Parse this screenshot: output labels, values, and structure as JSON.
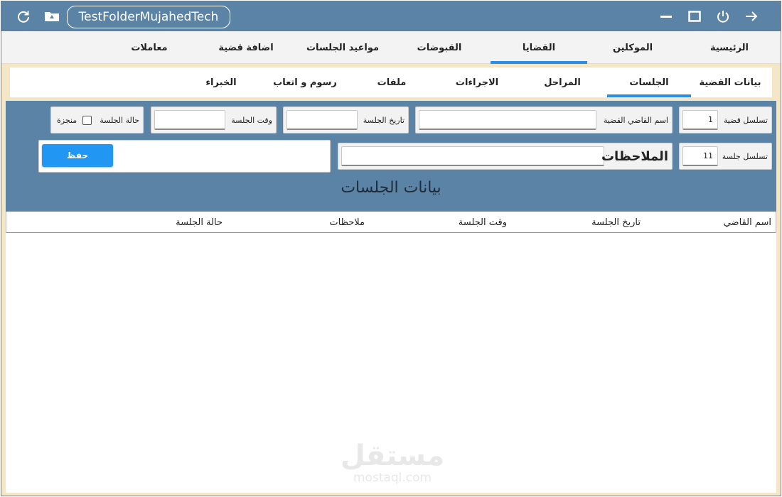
{
  "window": {
    "folder_title": "TestFolderMujahedTech"
  },
  "titlebar": {
    "icons": [
      "refresh-icon",
      "drive-folder-icon",
      "minimize-icon",
      "maximize-icon",
      "power-icon",
      "arrow-right-icon"
    ]
  },
  "main_nav": {
    "items": [
      "الرئيسية",
      "الموكلين",
      "القضايا",
      "القبوضات",
      "مواعيد الجلسات",
      "اضافة قضية",
      "معاملات"
    ],
    "active": "القضايا"
  },
  "sub_nav": {
    "items": [
      "بيانات القضية",
      "الجلسات",
      "المراحل",
      "الاجراءات",
      "ملفات",
      "رسوم و اتعاب",
      "الخبراء"
    ],
    "active": "الجلسات"
  },
  "form": {
    "case_serial_label": "تسلسل قضية",
    "case_serial_value": "1",
    "judge_name_label": "اسم القاضي القضية",
    "judge_name_value": "",
    "session_date_label": "تاريخ الجلسة",
    "session_date_value": "",
    "session_time_label": "وقت الجلسة",
    "session_time_value": "",
    "session_status_label": "حالة الجلسة",
    "completed_label": "منجزة",
    "completed_checked": false,
    "session_serial_label": "تسلسل جلسة",
    "session_serial_value": "11",
    "notes_label": "الملاحظات",
    "notes_value": "",
    "save_label": "حفظ",
    "heading": "بيانات الجلسات"
  },
  "table": {
    "columns": [
      "اسم القاضي",
      "تاريخ الجلسة",
      "وقت الجلسة",
      "ملاحظات",
      "حالة الجلسة"
    ],
    "rows": []
  },
  "watermark": {
    "arabic": "مستقل",
    "latin": "mostaql.com"
  },
  "colors": {
    "titlebar": "#5b83a6",
    "panel": "#5b83a6",
    "accent": "#2b8fe6",
    "save_button": "#2196f3",
    "frame": "#f6e6c8"
  }
}
